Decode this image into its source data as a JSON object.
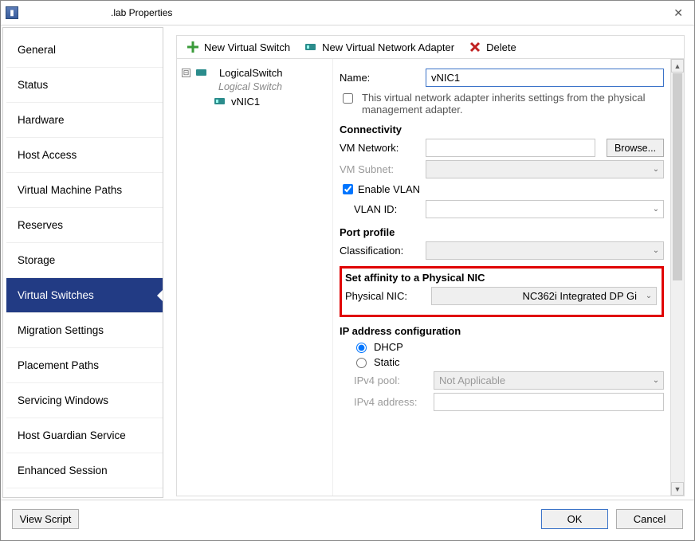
{
  "window": {
    "title": ".lab Properties",
    "close_icon": "✕"
  },
  "sidebar": {
    "items": [
      {
        "label": "General"
      },
      {
        "label": "Status"
      },
      {
        "label": "Hardware"
      },
      {
        "label": "Host Access"
      },
      {
        "label": "Virtual Machine Paths"
      },
      {
        "label": "Reserves"
      },
      {
        "label": "Storage"
      },
      {
        "label": "Virtual Switches",
        "selected": true
      },
      {
        "label": "Migration Settings"
      },
      {
        "label": "Placement Paths"
      },
      {
        "label": "Servicing Windows"
      },
      {
        "label": "Host Guardian Service"
      },
      {
        "label": "Enhanced Session"
      }
    ]
  },
  "toolbar": {
    "new_switch": "New Virtual Switch",
    "new_adapter": "New Virtual Network Adapter",
    "delete": "Delete"
  },
  "tree": {
    "root": "LogicalSwitch",
    "root_sub": "Logical Switch",
    "child": "vNIC1",
    "expand_glyph": "⊟"
  },
  "form": {
    "name_label": "Name:",
    "name_value": "vNIC1",
    "inherit_label": "This virtual network adapter inherits settings from the physical management adapter.",
    "connectivity_header": "Connectivity",
    "vm_network_label": "VM Network:",
    "vm_network_value": "",
    "browse_label": "Browse...",
    "vm_subnet_label": "VM Subnet:",
    "vm_subnet_value": "",
    "enable_vlan_label": "Enable VLAN",
    "vlan_id_label": "VLAN ID:",
    "vlan_id_value": "",
    "port_profile_header": "Port profile",
    "classification_label": "Classification:",
    "classification_value": "",
    "affinity_header": "Set affinity to a Physical NIC",
    "physical_nic_label": "Physical NIC:",
    "physical_nic_value": "NC362i Integrated DP Gi",
    "ip_header": "IP address configuration",
    "dhcp_label": "DHCP",
    "static_label": "Static",
    "ipv4_pool_label": "IPv4 pool:",
    "ipv4_pool_value": "Not Applicable",
    "ipv4_addr_label": "IPv4 address:",
    "ipv4_addr_value": ""
  },
  "footer": {
    "view_script": "View Script",
    "ok": "OK",
    "cancel": "Cancel"
  },
  "glyphs": {
    "chevron_down": "⌄",
    "arrow_up": "▲",
    "arrow_down": "▼"
  }
}
